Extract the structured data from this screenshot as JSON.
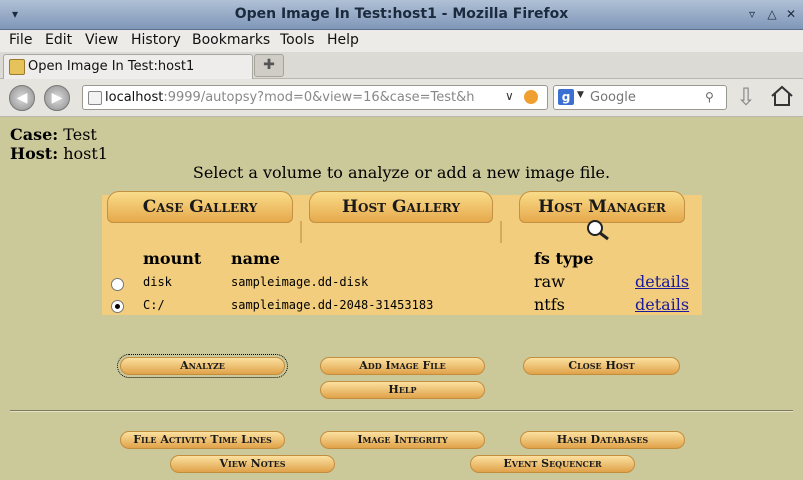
{
  "window": {
    "title": "Open Image In Test:host1 - Mozilla Firefox"
  },
  "menu": [
    "File",
    "Edit",
    "View",
    "History",
    "Bookmarks",
    "Tools",
    "Help"
  ],
  "tab": {
    "label": "Open Image In Test:host1"
  },
  "nav": {
    "url_host": "localhost",
    "url_rest": ":9999/autopsy?mod=0&view=16&case=Test&h",
    "search_engine": "g",
    "search_placeholder": "Google"
  },
  "page": {
    "case_label": "Case:",
    "case_value": "Test",
    "host_label": "Host:",
    "host_value": "host1",
    "instruction": "Select a volume to analyze or add a new image file.",
    "tabs": [
      "Case Gallery",
      "Host Gallery",
      "Host Manager"
    ],
    "table": {
      "headers": {
        "mount": "mount",
        "name": "name",
        "fs_type": "fs type"
      },
      "rows": [
        {
          "mount": "disk",
          "name": "sampleimage.dd-disk",
          "fs_type": "raw",
          "link": "details",
          "selected": false
        },
        {
          "mount": "C:/",
          "name": "sampleimage.dd-2048-31453183",
          "fs_type": "ntfs",
          "link": "details",
          "selected": true
        }
      ]
    },
    "buttons": {
      "analyze": "Analyze",
      "add_image": "Add Image File",
      "close_host": "Close Host",
      "help": "Help",
      "file_activity": "File Activity Time Lines",
      "image_integrity": "Image Integrity",
      "hash_databases": "Hash Databases",
      "view_notes": "View Notes",
      "event_sequencer": "Event Sequencer"
    }
  }
}
